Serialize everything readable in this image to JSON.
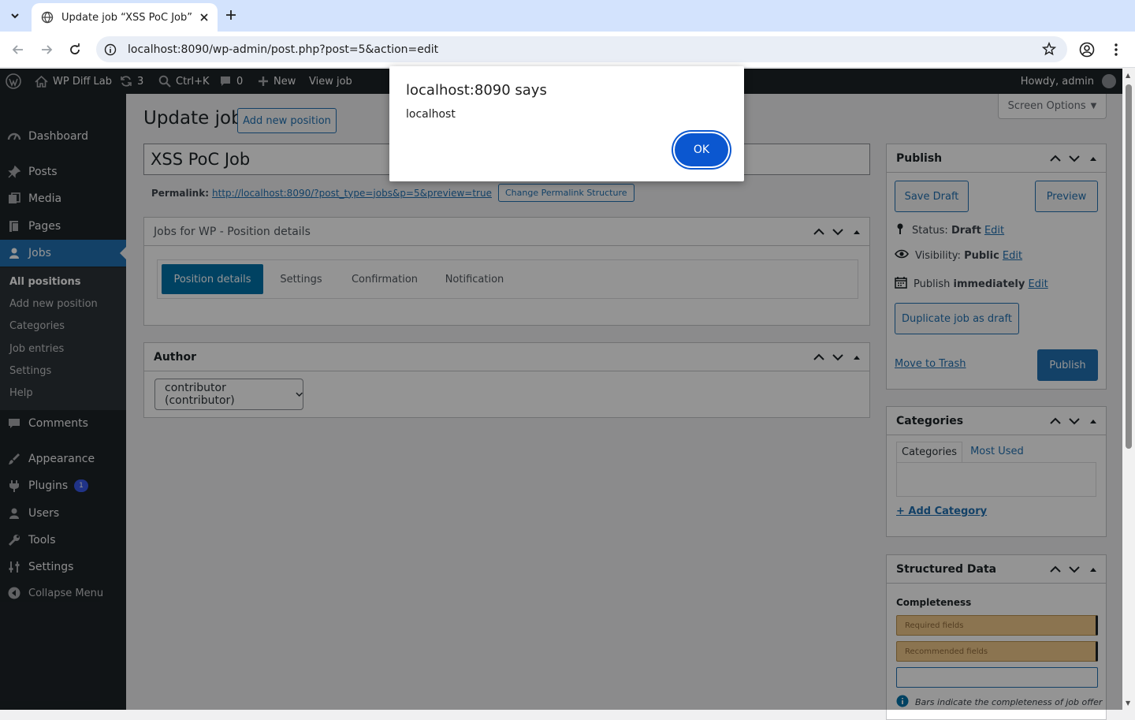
{
  "browser": {
    "tab_title": "Update job “XSS PoC Job”",
    "url": "localhost:8090/wp-admin/post.php?post=5&action=edit"
  },
  "adminbar": {
    "site_name": "WP Diff Lab",
    "updates_count": "3",
    "search_shortcut": "Ctrl+K",
    "comments_count": "0",
    "new_label": "New",
    "view_label": "View job",
    "howdy": "Howdy, admin"
  },
  "sidebar": {
    "items": [
      {
        "label": "Dashboard",
        "icon": "dashboard-icon"
      },
      {
        "label": "Posts",
        "icon": "pin-icon"
      },
      {
        "label": "Media",
        "icon": "media-icon"
      },
      {
        "label": "Pages",
        "icon": "pages-icon"
      },
      {
        "label": "Jobs",
        "icon": "jobs-icon"
      },
      {
        "label": "Comments",
        "icon": "comments-icon"
      },
      {
        "label": "Appearance",
        "icon": "appearance-icon"
      },
      {
        "label": "Plugins",
        "icon": "plugins-icon",
        "badge": "1"
      },
      {
        "label": "Users",
        "icon": "users-icon"
      },
      {
        "label": "Tools",
        "icon": "tools-icon"
      },
      {
        "label": "Settings",
        "icon": "settings-icon"
      },
      {
        "label": "Collapse Menu",
        "icon": "collapse-icon"
      }
    ],
    "jobs_submenu": [
      "All positions",
      "Add new position",
      "Categories",
      "Job entries",
      "Settings",
      "Help"
    ]
  },
  "main": {
    "screen_options": "Screen Options",
    "page_title": "Update job",
    "add_new_label": "Add new position",
    "post_title": "XSS PoC Job",
    "permalink_label": "Permalink:",
    "permalink_url": "http://localhost:8090/?post_type=jobs&p=5&preview=true",
    "change_permalink_label": "Change Permalink Structure",
    "position_box": {
      "title": "Jobs for WP - Position details",
      "tabs": [
        "Position details",
        "Settings",
        "Confirmation",
        "Notification"
      ]
    },
    "author_box": {
      "title": "Author",
      "selected": "contributor (contributor)"
    }
  },
  "publish": {
    "title": "Publish",
    "save_draft": "Save Draft",
    "preview": "Preview",
    "status_label": "Status:",
    "status_value": "Draft",
    "visibility_label": "Visibility:",
    "visibility_value": "Public",
    "publish_label": "Publish",
    "publish_when": "immediately",
    "edit": "Edit",
    "duplicate": "Duplicate job as draft",
    "trash": "Move to Trash",
    "publish_button": "Publish"
  },
  "categories": {
    "title": "Categories",
    "tab_all": "Categories",
    "tab_most_used": "Most Used",
    "add_category": "+ Add Category"
  },
  "structured": {
    "title": "Structured Data",
    "completeness": "Completeness",
    "bars": [
      {
        "label": "Required fields",
        "fill": 1.0
      },
      {
        "label": "Recommended fields",
        "fill": 1.0
      },
      {
        "label": "",
        "fill": 0.0
      }
    ],
    "note": "Bars indicate the completeness of job offer"
  },
  "dialog": {
    "title": "localhost:8090 says",
    "message": "localhost",
    "ok": "OK"
  },
  "colors": {
    "admin_dark": "#1d2327",
    "wp_blue": "#2271b1",
    "dialog_blue": "#0b57d0",
    "tab_active": "#0073aa"
  }
}
